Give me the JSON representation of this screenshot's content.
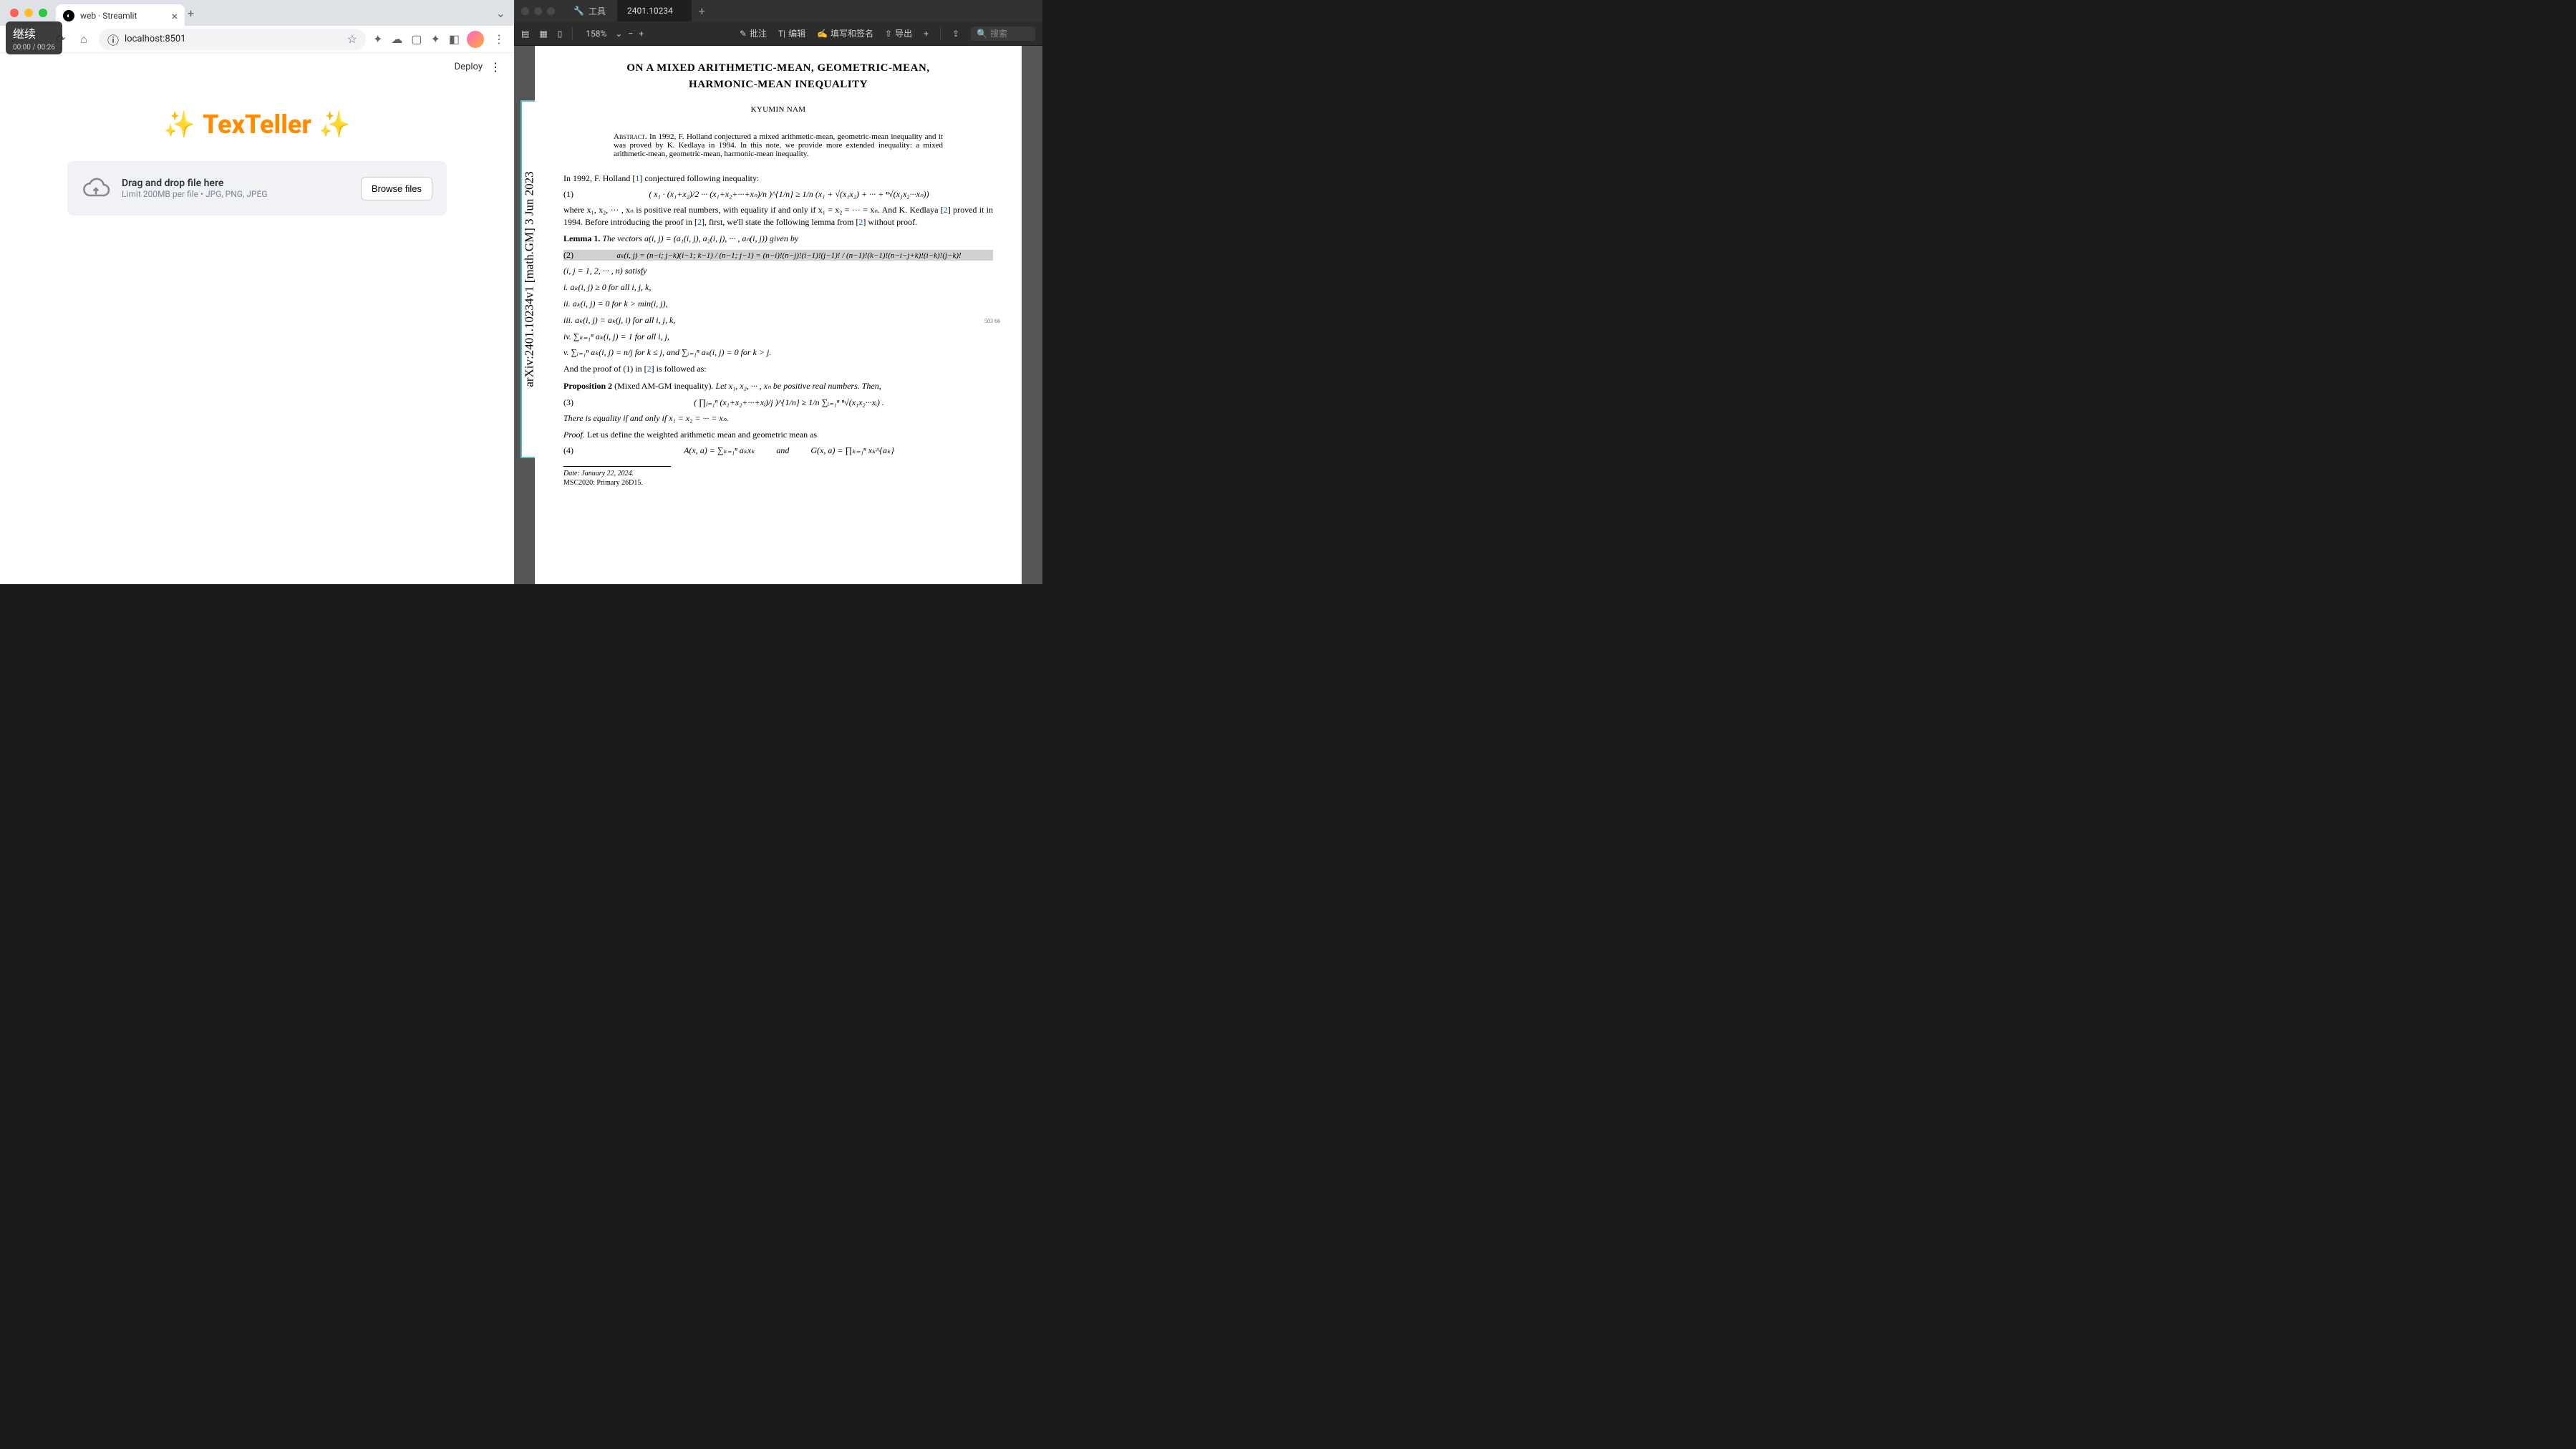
{
  "recording": {
    "label": "继续",
    "time": "00:00 / 00:26"
  },
  "browser": {
    "tab": {
      "title": "web · Streamlit"
    },
    "url": "localhost:8501",
    "new_tab": "+",
    "dropdown": "⌄",
    "nav": {
      "back": "←",
      "fwd": "→",
      "reload": "⟳",
      "home": "⌂",
      "lock": "ⓘ",
      "star": "☆",
      "menu": "⋮"
    }
  },
  "streamlit": {
    "deploy": "Deploy",
    "title": "TexTeller",
    "uploader": {
      "line1": "Drag and drop file here",
      "line2": "Limit 200MB per file • JPG, PNG, JPEG",
      "button": "Browse files"
    }
  },
  "pdf": {
    "tools_label": "工具",
    "tab_name": "2401.10234",
    "zoom": "158%",
    "toolbar": {
      "annotate": "批注",
      "edit": "编辑",
      "fillsign": "填写和签名",
      "export": "导出",
      "search_ph": "搜索"
    },
    "arxiv_stamp": "arXiv:2401.10234v1  [math.GM]  3 Jun 2023",
    "title": "ON A MIXED ARITHMETIC-MEAN, GEOMETRIC-MEAN, HARMONIC-MEAN INEQUALITY",
    "author": "KYUMIN NAM",
    "abstract_label": "Abstract.",
    "abstract": "In 1992, F. Holland conjectured a mixed arithmetic-mean, geometric-mean inequality and it was proved by K. Kedlaya in 1994. In this note, we provide more extended inequality: a mixed arithmetic-mean, geometric-mean, harmonic-mean inequality.",
    "p1_a": "In 1992, F. Holland [",
    "p1_cite1": "1",
    "p1_b": "] conjectured following inequality:",
    "eq1_num": "(1)",
    "eq1": "( x₁ · (x₁+x₂)/2 ··· (x₁+x₂+···+xₙ)/n )^{1/n} ≥ 1/n (x₁ + √(x₁x₂) + ··· + ⁿ√(x₁x₂···xₙ))",
    "p2": "where x₁, x₂, ··· , xₙ is positive real numbers, with equality if and only if x₁ = x₂ = ··· = xₙ. And K. Kedlaya [",
    "p2_cite": "2",
    "p2_b": "] proved it in 1994. Before introducing the proof in [",
    "p2_cite2": "2",
    "p2_c": "], first, we'll state the following lemma from [",
    "p2_cite3": "2",
    "p2_d": "] without proof.",
    "lemma_label": "Lemma 1.",
    "lemma_text": "The vectors a(i, j) = (a₁(i, j), a₂(i, j), ··· , aₙ(i, j)) given by",
    "eq2_num": "(2)",
    "eq2": "aₖ(i, j) = (n−i; j−k)(i−1; k−1) / (n−1; j−1) = (n−i)!(n−j)!(i−1)!(j−1)! / (n−1)!(k−1)!(n−i−j+k)!(i−k)!(j−k)!",
    "p3": "(i, j = 1, 2, ··· , n) satisfy",
    "li1": "i.  aₖ(i, j) ≥ 0 for all i, j, k,",
    "li2": "ii.  aₖ(i, j) = 0 for k > min(i, j),",
    "li3": "iii.  aₖ(i, j) = aₖ(j, i) for all i, j, k,",
    "li4": "iv.  ∑ₖ₌₁ⁿ aₖ(i, j) = 1 for all i, j,",
    "li5": "v.  ∑ᵢ₌₁ⁿ aₖ(i, j) = n/j for k ≤ j, and ∑ᵢ₌₁ⁿ aₖ(i, j) = 0 for k > j.",
    "p4_a": "And the proof of (1) in [",
    "p4_cite": "2",
    "p4_b": "] is followed as:",
    "prop_label": "Proposition 2",
    "prop_paren": " (Mixed AM-GM inequality)",
    "prop_text": ".  Let x₁, x₂, ··· , xₙ be positive real numbers. Then,",
    "eq3_num": "(3)",
    "eq3": "( ∏ⱼ₌₁ⁿ (x₁+x₂+···+xⱼ)/j )^{1/n} ≥ 1/n ∑ᵢ₌₁ⁿ ⁿ√(x₁x₂···xᵢ) .",
    "p5": "There is equality if and only if x₁ = x₂ = ··· = xₙ.",
    "proof_label": "Proof.",
    "proof_text": "Let us define the weighted arithmetic mean and geometric mean as",
    "eq4_num": "(4)",
    "eq4": "A(x, a) = ∑ₖ₌₁ⁿ aₖxₖ          and          G(x, a) = ∏ₖ₌₁ⁿ xₖ^{aₖ}",
    "foot_date": "Date: January 22, 2024.",
    "foot_msc": "MSC2020: Primary 26D15.",
    "cursor": "503\n66"
  }
}
